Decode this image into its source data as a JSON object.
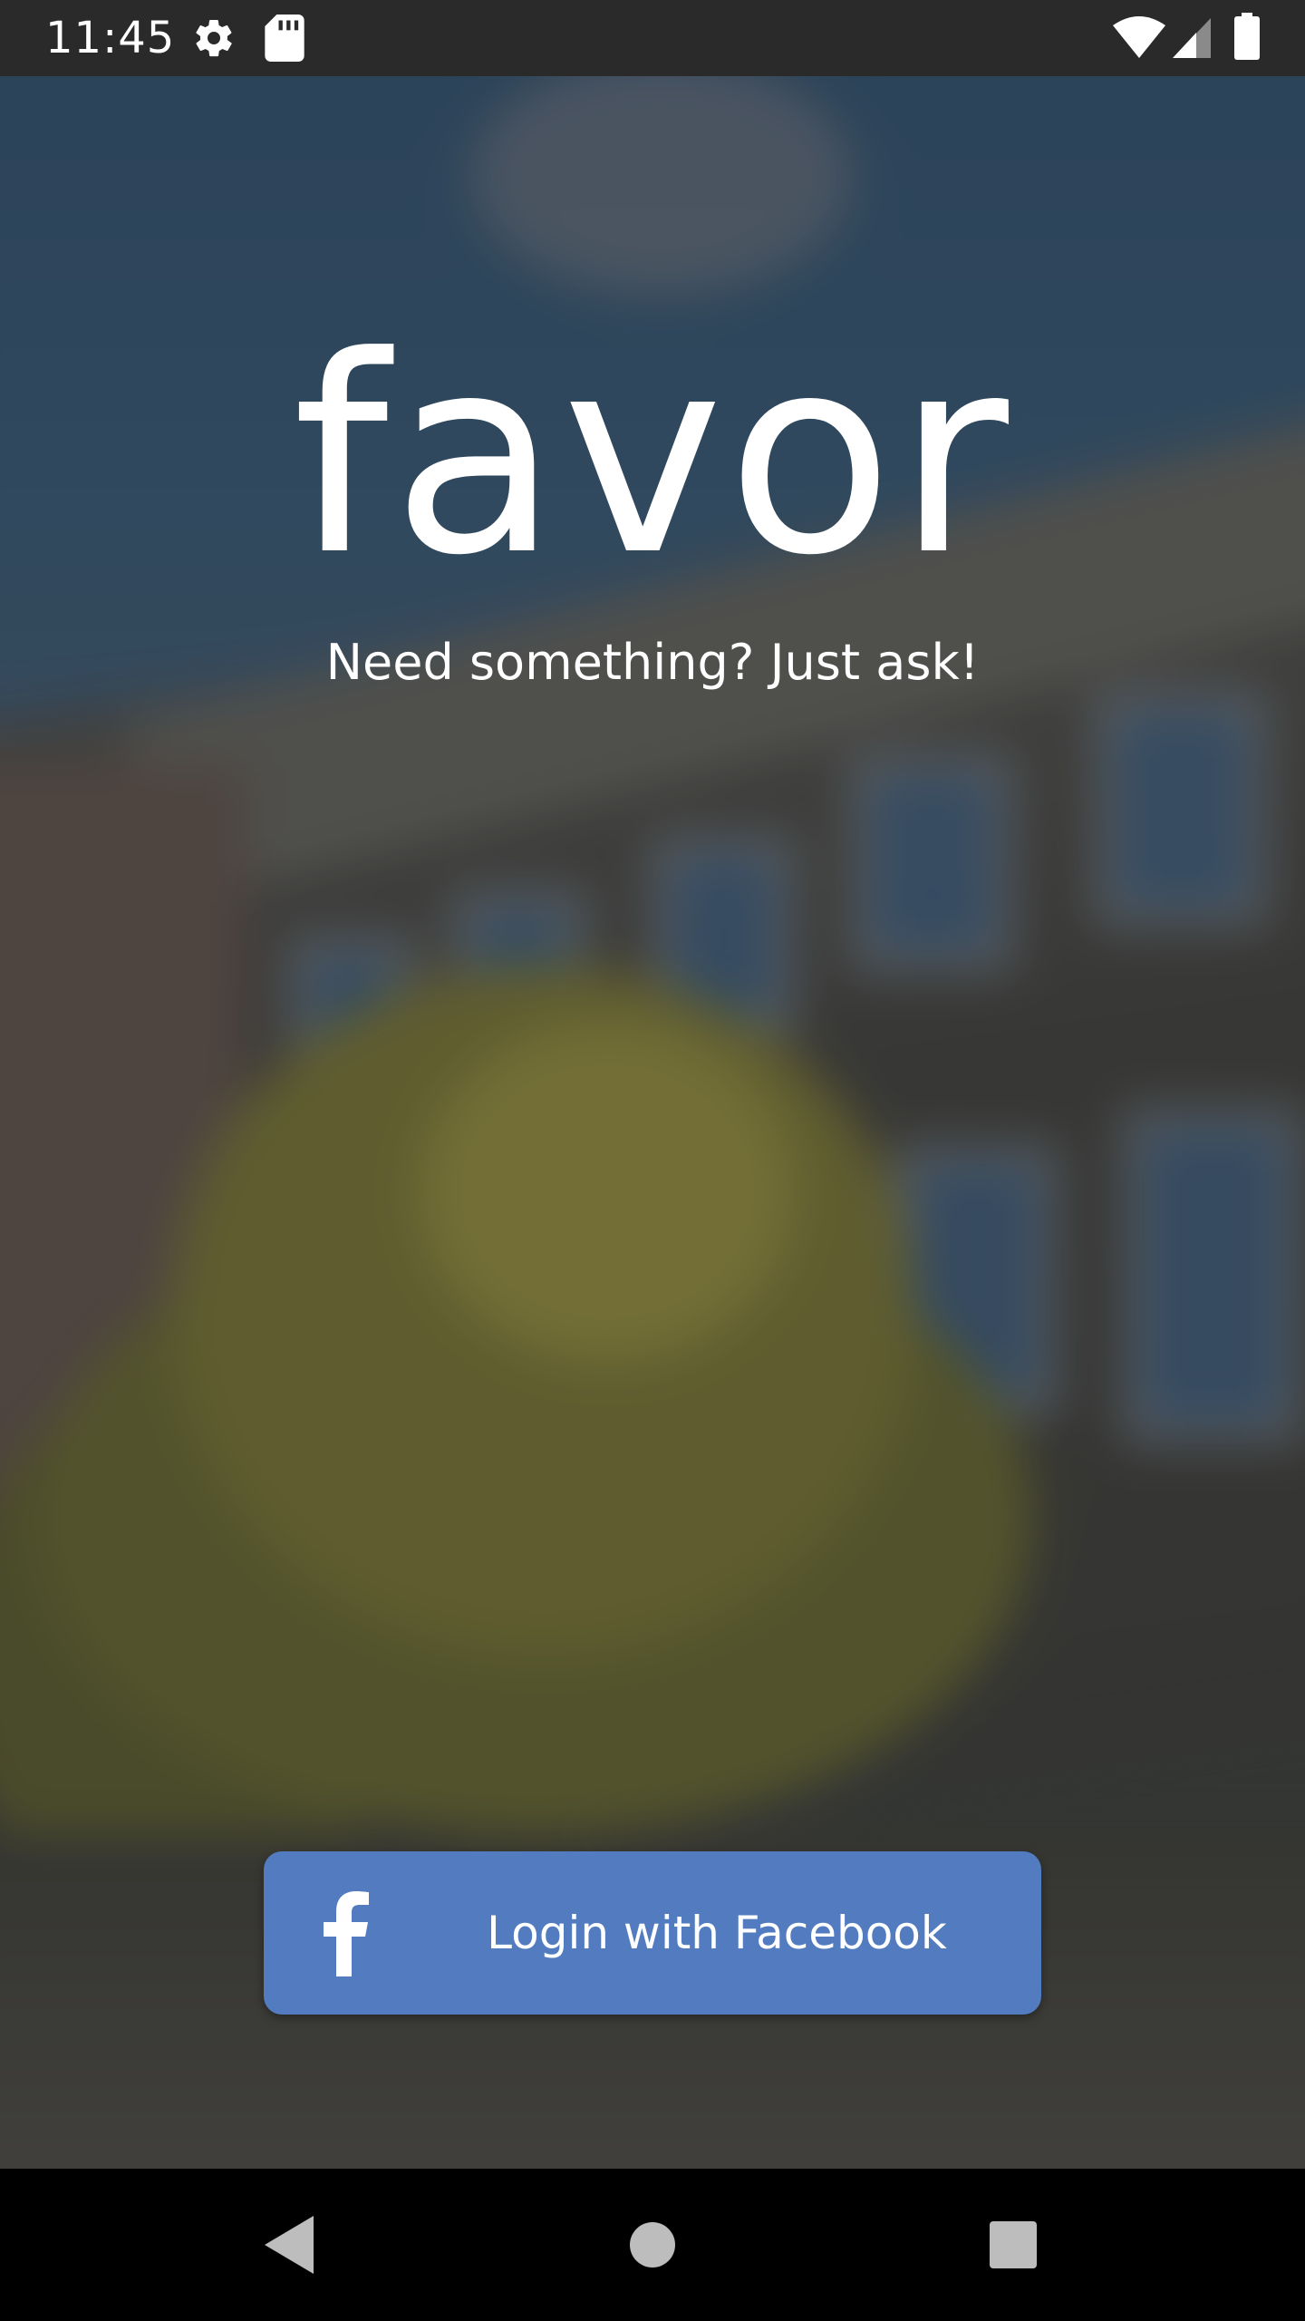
{
  "status_bar": {
    "time": "11:45",
    "icons": [
      "settings-gear-icon",
      "sd-card-icon",
      "wifi-icon",
      "cell-signal-icon",
      "battery-icon"
    ]
  },
  "app": {
    "logo": "favor",
    "tagline": "Need something? Just ask!",
    "login_button": {
      "label": "Login with Facebook",
      "icon": "facebook-f-icon",
      "color": "#527cbf"
    }
  },
  "nav_bar": {
    "buttons": [
      "back-icon",
      "home-icon",
      "recents-icon"
    ]
  },
  "colors": {
    "status_bar": "#2a2a2a",
    "text": "#ffffff",
    "nav_bar": "#000000",
    "facebook_blue": "#527cbf"
  }
}
